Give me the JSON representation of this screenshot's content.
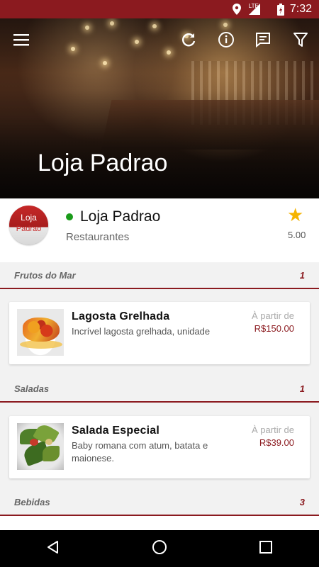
{
  "status_bar": {
    "time": "7:32",
    "network": "LTE",
    "icons": [
      "location-icon",
      "signal-icon",
      "battery-icon"
    ]
  },
  "toolbar": {
    "icons": [
      "menu-icon",
      "refresh-icon",
      "info-icon",
      "chat-icon",
      "filter-icon"
    ]
  },
  "hero": {
    "title": "Loja Padrao"
  },
  "store": {
    "logo_line1": "Loja",
    "logo_line2": "Padrao",
    "name": "Loja Padrao",
    "category": "Restaurantes",
    "rating": "5.00",
    "online_color": "#1a9b1a"
  },
  "sections": [
    {
      "name": "Frutos do Mar",
      "count": "1",
      "products": [
        {
          "title": "Lagosta Grelhada",
          "description": "Incrível lagosta grelhada, unidade",
          "from_label": "À partir de",
          "price": "R$150.00"
        }
      ]
    },
    {
      "name": "Saladas",
      "count": "1",
      "products": [
        {
          "title": "Salada Especial",
          "description": "Baby romana com atum, batata e maionese.",
          "from_label": "À partir de",
          "price": "R$39.00"
        }
      ]
    },
    {
      "name": "Bebidas",
      "count": "3"
    }
  ],
  "nav": {
    "icons": [
      "back-icon",
      "home-icon",
      "recents-icon"
    ]
  },
  "colors": {
    "brand": "#8b1a1f",
    "star": "#f5b400"
  }
}
